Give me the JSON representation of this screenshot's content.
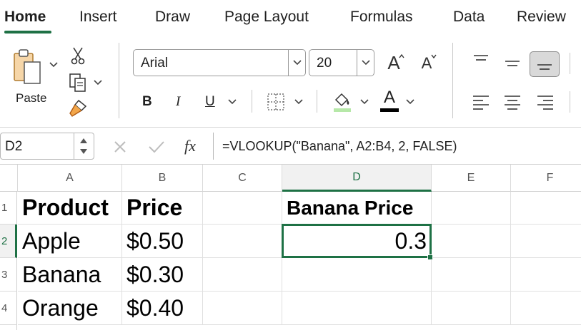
{
  "tabs": [
    {
      "label": "Home",
      "active": true
    },
    {
      "label": "Insert"
    },
    {
      "label": "Draw"
    },
    {
      "label": "Page Layout"
    },
    {
      "label": "Formulas"
    },
    {
      "label": "Data"
    },
    {
      "label": "Review"
    }
  ],
  "ribbon": {
    "paste_label": "Paste",
    "font_name": "Arial",
    "font_size": "20",
    "bold_label": "B",
    "italic_label": "I",
    "underline_label": "U",
    "grow_font_label": "A",
    "shrink_font_label": "A",
    "font_color_label": "A",
    "accent_color": "#1e7145",
    "highlight_color": "#b6e8a8",
    "font_color": "#000000",
    "icons": [
      "paste-icon",
      "cut-icon",
      "copy-icon",
      "format-painter-icon",
      "borders-icon",
      "fill-color-icon",
      "font-color-icon",
      "align-top-icon",
      "align-middle-icon",
      "align-bottom-icon",
      "align-left-icon",
      "align-center-icon",
      "align-right-icon"
    ]
  },
  "formula_bar": {
    "name_box": "D2",
    "fx_label": "fx",
    "formula": "=VLOOKUP(\"Banana\", A2:B4, 2, FALSE)"
  },
  "sheet": {
    "columns": [
      "A",
      "B",
      "C",
      "D",
      "E",
      "F"
    ],
    "rows": [
      "1",
      "2",
      "3",
      "4"
    ],
    "selected_cell": "D2",
    "cells": {
      "A1": "Product",
      "B1": "Price",
      "D1": "Banana Price",
      "A2": "Apple",
      "B2": "$0.50",
      "D2": "0.3",
      "A3": "Banana",
      "B3": "$0.30",
      "A4": "Orange",
      "B4": "$0.40"
    }
  }
}
